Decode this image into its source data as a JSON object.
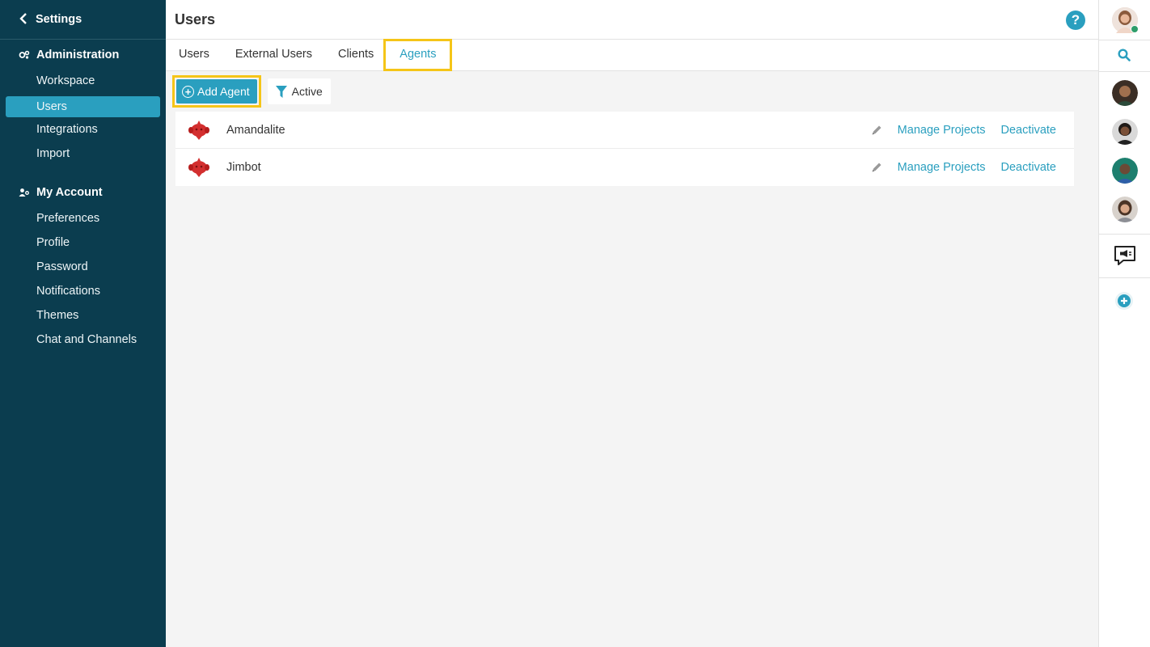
{
  "sidebar": {
    "back_label": "Settings",
    "sections": [
      {
        "label": "Administration",
        "icon": "gears-icon",
        "items": [
          "Workspace",
          "Users",
          "Integrations",
          "Import"
        ]
      },
      {
        "label": "My Account",
        "icon": "user-group-icon",
        "items": [
          "Preferences",
          "Profile",
          "Password",
          "Notifications",
          "Themes",
          "Chat and Channels"
        ]
      }
    ],
    "active_item": "Users"
  },
  "header": {
    "title": "Users",
    "help_label": "?"
  },
  "tabs": [
    {
      "label": "Users"
    },
    {
      "label": "External Users"
    },
    {
      "label": "Clients"
    },
    {
      "label": "Agents",
      "active": true
    }
  ],
  "toolbar": {
    "add_label": "Add Agent",
    "filter_label": "Active"
  },
  "agents": [
    {
      "name": "Amandalite",
      "manage_label": "Manage Projects",
      "deactivate_label": "Deactivate"
    },
    {
      "name": "Jimbot",
      "manage_label": "Manage Projects",
      "deactivate_label": "Deactivate"
    }
  ],
  "colors": {
    "sidebar_bg": "#0b3d4f",
    "accent": "#2a9fbf",
    "highlight": "#f5c518",
    "agent_icon": "#d32f2f"
  }
}
